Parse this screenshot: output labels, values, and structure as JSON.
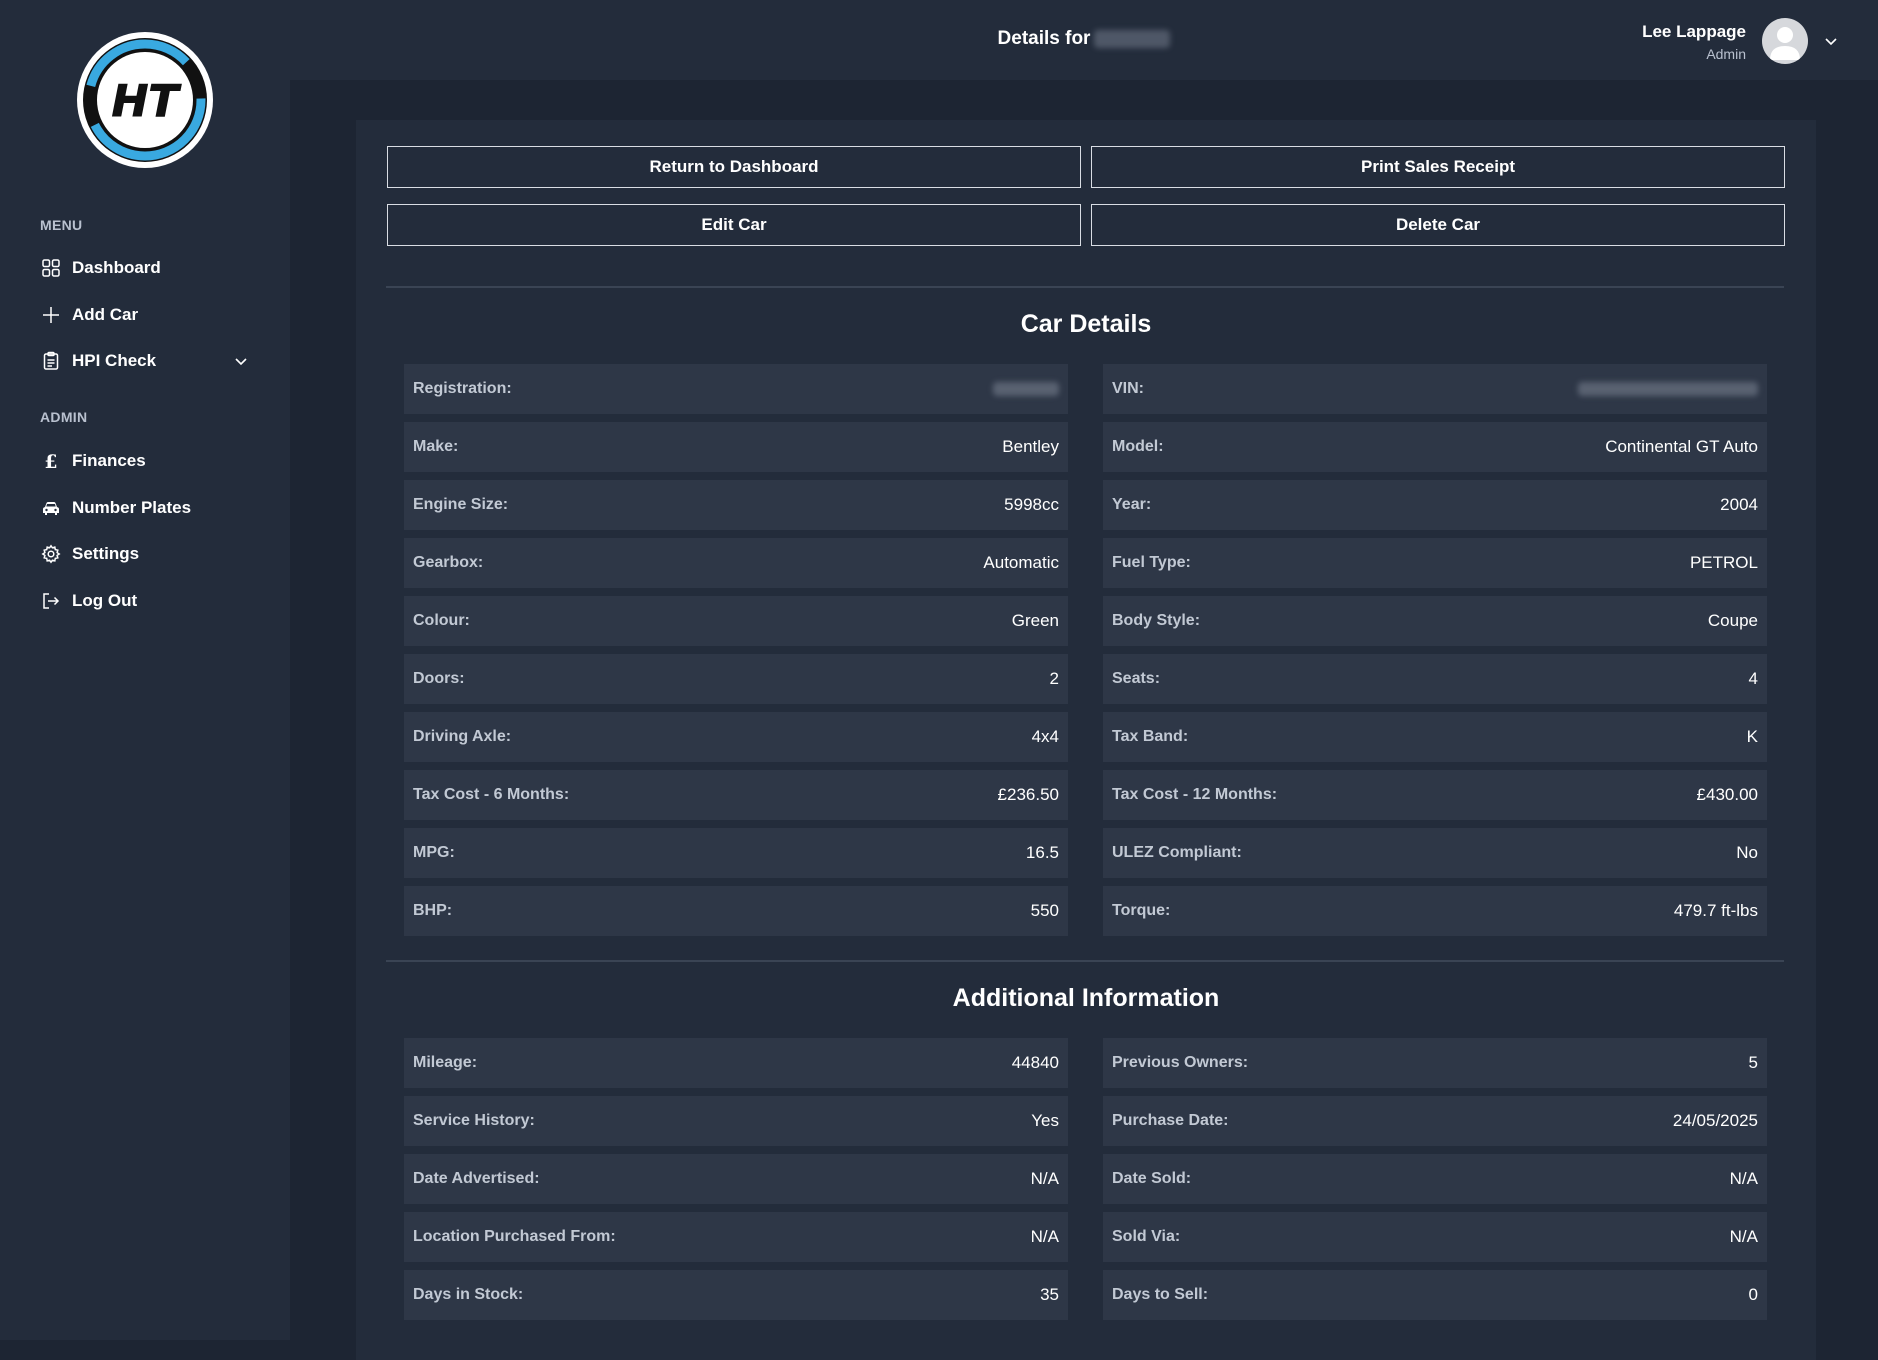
{
  "sidebar": {
    "logo_text": "HT",
    "menu_heading": "MENU",
    "admin_heading": "ADMIN",
    "items": [
      {
        "label": "Dashboard",
        "icon": "grid-icon"
      },
      {
        "label": "Add Car",
        "icon": "plus-icon"
      },
      {
        "label": "HPI Check",
        "icon": "clipboard-icon"
      },
      {
        "label": "Finances",
        "icon": "pound-icon"
      },
      {
        "label": "Number Plates",
        "icon": "car-icon"
      },
      {
        "label": "Settings",
        "icon": "gear-icon"
      },
      {
        "label": "Log Out",
        "icon": "logout-icon"
      }
    ]
  },
  "header": {
    "title": "Details for",
    "user_name": "Lee Lappage",
    "user_role": "Admin"
  },
  "actions": {
    "return": "Return to Dashboard",
    "print": "Print Sales Receipt",
    "edit": "Edit Car",
    "delete": "Delete Car"
  },
  "car_details": {
    "title": "Car Details",
    "left": [
      {
        "label": "Registration:",
        "value": ""
      },
      {
        "label": "Make:",
        "value": "Bentley"
      },
      {
        "label": "Engine Size:",
        "value": "5998cc"
      },
      {
        "label": "Gearbox:",
        "value": "Automatic"
      },
      {
        "label": "Colour:",
        "value": "Green"
      },
      {
        "label": "Doors:",
        "value": "2"
      },
      {
        "label": "Driving Axle:",
        "value": "4x4"
      },
      {
        "label": "Tax Cost - 6 Months:",
        "value": "£236.50"
      },
      {
        "label": "MPG:",
        "value": "16.5"
      },
      {
        "label": "BHP:",
        "value": "550"
      }
    ],
    "right": [
      {
        "label": "VIN:",
        "value": ""
      },
      {
        "label": "Model:",
        "value": "Continental GT Auto"
      },
      {
        "label": "Year:",
        "value": "2004"
      },
      {
        "label": "Fuel Type:",
        "value": "PETROL"
      },
      {
        "label": "Body Style:",
        "value": "Coupe"
      },
      {
        "label": "Seats:",
        "value": "4"
      },
      {
        "label": "Tax Band:",
        "value": "K"
      },
      {
        "label": "Tax Cost - 12 Months:",
        "value": "£430.00"
      },
      {
        "label": "ULEZ Compliant:",
        "value": "No"
      },
      {
        "label": "Torque:",
        "value": "479.7 ft-lbs"
      }
    ]
  },
  "additional": {
    "title": "Additional Information",
    "left": [
      {
        "label": "Mileage:",
        "value": "44840"
      },
      {
        "label": "Service History:",
        "value": "Yes"
      },
      {
        "label": "Date Advertised:",
        "value": "N/A"
      },
      {
        "label": "Location Purchased From:",
        "value": "N/A"
      },
      {
        "label": "Days in Stock:",
        "value": "35"
      }
    ],
    "right": [
      {
        "label": "Previous Owners:",
        "value": "5"
      },
      {
        "label": "Purchase Date:",
        "value": "24/05/2025"
      },
      {
        "label": "Date Sold:",
        "value": "N/A"
      },
      {
        "label": "Sold Via:",
        "value": "N/A"
      },
      {
        "label": "Days to Sell:",
        "value": "0"
      }
    ]
  },
  "colors": {
    "background": "#1d2533",
    "panel": "#232c3b",
    "row": "#2e3747",
    "logo_accent": "#39a9e0"
  }
}
